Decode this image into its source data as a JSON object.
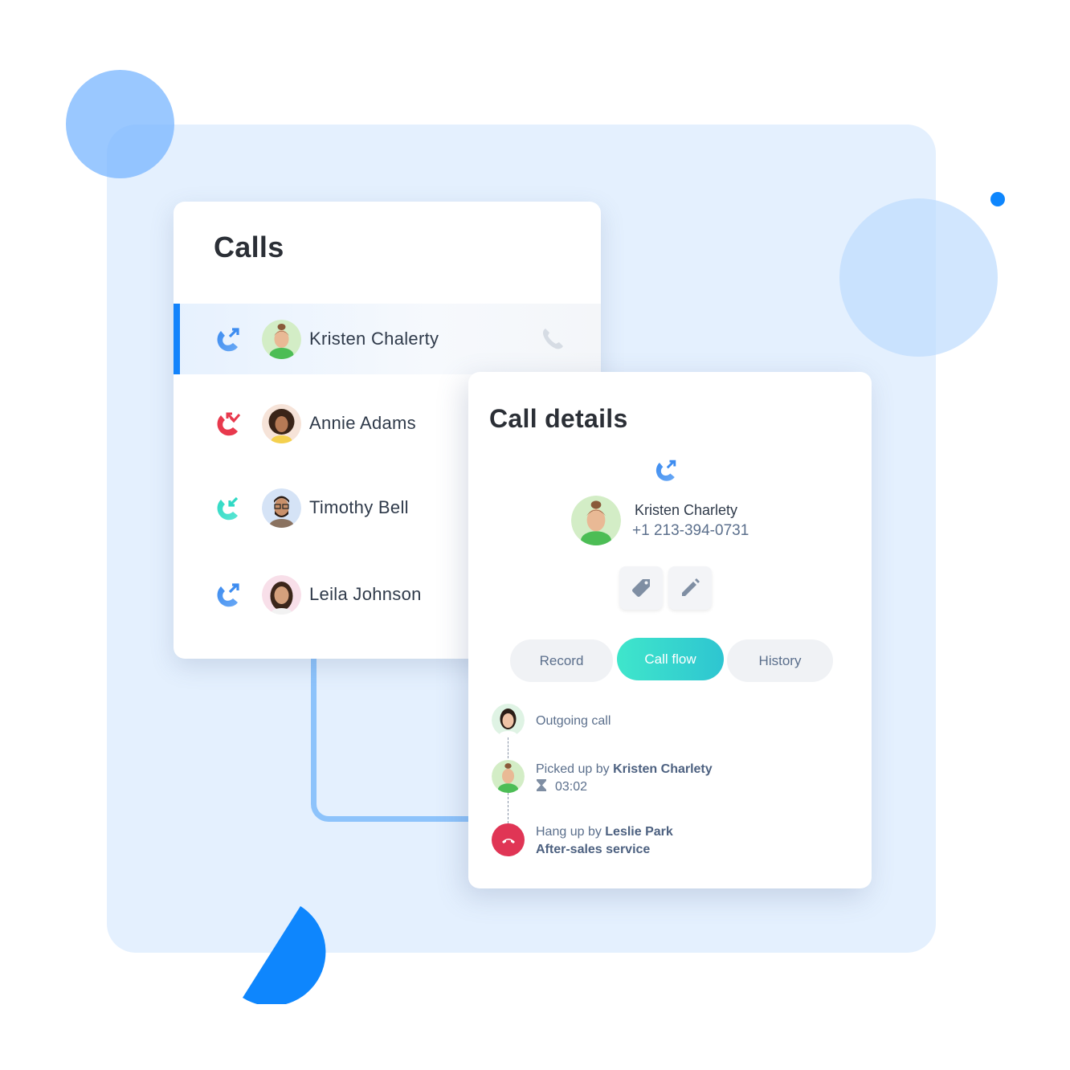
{
  "calls": {
    "title": "Calls",
    "items": [
      {
        "name": "Kristen Chalerty",
        "direction": "outgoing",
        "direction_icon": "outgoing-call-icon",
        "selected": true,
        "action_icon": "phone-icon"
      },
      {
        "name": "Annie Adams",
        "direction": "missed",
        "direction_icon": "missed-call-icon",
        "selected": false
      },
      {
        "name": "Timothy Bell",
        "direction": "incoming",
        "direction_icon": "incoming-call-icon",
        "selected": false
      },
      {
        "name": "Leila Johnson",
        "direction": "outgoing",
        "direction_icon": "outgoing-call-icon",
        "selected": false
      }
    ]
  },
  "details": {
    "title": "Call details",
    "direction_icon": "outgoing-call-icon",
    "contact_name": "Kristen Charlety",
    "contact_phone": "+1 213-394-0731",
    "actions": [
      {
        "icon": "tag-icon",
        "label": "Tag"
      },
      {
        "icon": "pencil-icon",
        "label": "Edit"
      }
    ],
    "tabs": [
      {
        "label": "Record",
        "active": false
      },
      {
        "label": "Call flow",
        "active": true
      },
      {
        "label": "History",
        "active": false
      }
    ],
    "flow": [
      {
        "text": "Outgoing call"
      },
      {
        "prefix": "Picked up by ",
        "bold": "Kristen Charlety",
        "duration_icon": "hourglass-icon",
        "duration": "03:02"
      },
      {
        "prefix": "Hang up by ",
        "bold": "Leslie Park",
        "subtitle": "After-sales service",
        "icon": "hang-up-icon"
      }
    ]
  },
  "colors": {
    "accent_blue": "#1383fb",
    "call_flow_teal": "#3fe6cb",
    "missed_red": "#e8394d",
    "hang_up_red": "#e03555",
    "background_panel": "#e4f0fe"
  }
}
